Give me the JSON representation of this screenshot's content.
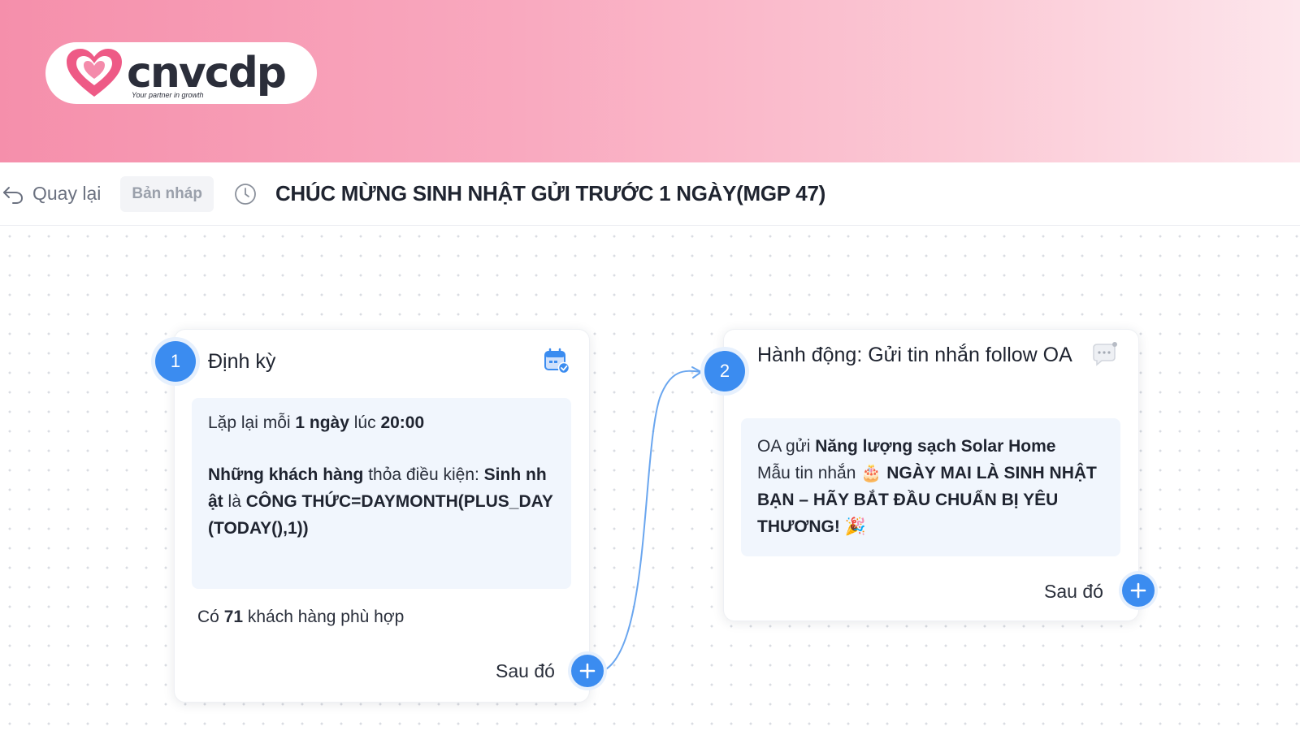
{
  "brand": {
    "logo_word": "cnvcdp",
    "tagline": "Your partner in growth",
    "colors": {
      "heart": "#ee5a86",
      "accent": "#3b8cf0"
    }
  },
  "header": {
    "back_label": "Quay lại",
    "status_badge": "Bản nháp",
    "title": "CHÚC MỪNG SINH NHẬT GỬI TRƯỚC 1 NGÀY(MGP 47)"
  },
  "nodes": [
    {
      "step": "1",
      "title": "Định kỳ",
      "icon": "calendar-check-icon",
      "repeat_prefix": "Lặp lại mỗi ",
      "repeat_interval": "1 ngày",
      "repeat_mid": " lúc ",
      "repeat_time": "20:00",
      "cond_subject": "Những khách hàng",
      "cond_mid": " thỏa điều kiện: ",
      "cond_field": "Sinh nhật",
      "cond_op": " là ",
      "cond_value": "CÔNG THỨC=DAYMONTH(PLUS_DAY(TODAY(),1))",
      "count_prefix": "Có ",
      "count_value": "71",
      "count_suffix": " khách hàng phù hợp",
      "next_label": "Sau đó"
    },
    {
      "step": "2",
      "title": "Hành động: Gửi tin nhắn follow OA",
      "icon": "chat-bubble-icon",
      "sender_prefix": "OA gửi ",
      "sender_name": "Năng lượng sạch Solar Home",
      "template_prefix": "Mẫu tin nhắn ",
      "template_emoji": "🎂",
      "template_name": "NGÀY MAI LÀ SINH NHẬT BẠN – HÃY BẮT ĐẦU CHUẨN BỊ YÊU THƯƠNG!",
      "template_emoji_end": "🎉",
      "next_label": "Sau đó"
    }
  ]
}
